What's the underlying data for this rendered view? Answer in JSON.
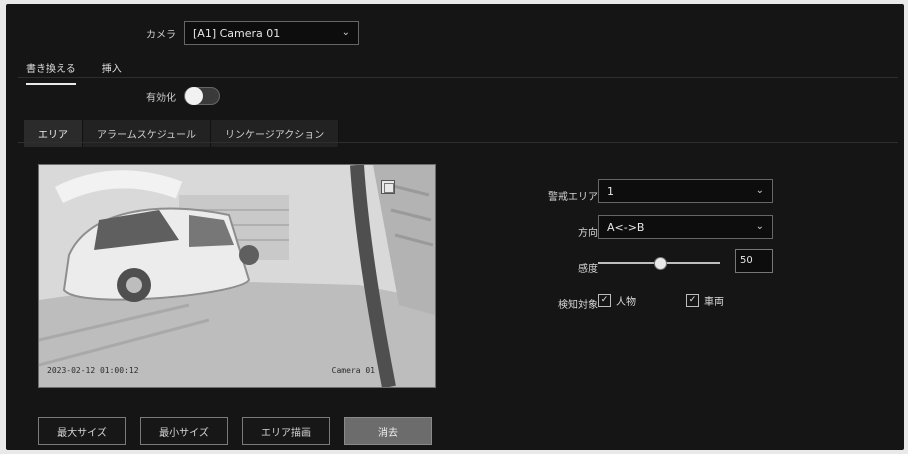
{
  "camera": {
    "label": "カメラ",
    "selected": "[A1] Camera 01"
  },
  "subnav": {
    "items": [
      "書き換える",
      "挿入"
    ]
  },
  "enable": {
    "label": "有効化",
    "on": false
  },
  "tabs": [
    "エリア",
    "アラームスケジュール",
    "リンケージアクション"
  ],
  "preview": {
    "timestamp": "2023-02-12 01:00:12",
    "camera_name": "Camera 01"
  },
  "form": {
    "area_label": "警戒エリア",
    "area_value": "1",
    "direction_label": "方向",
    "direction_value": "A<->B",
    "sensitivity_label": "感度",
    "sensitivity_value": "50",
    "sensitivity_fraction": 0.5,
    "target_label": "検知対象",
    "target_options": [
      {
        "label": "人物",
        "checked": true
      },
      {
        "label": "車両",
        "checked": true
      }
    ]
  },
  "buttons": [
    "最大サイズ",
    "最小サイズ",
    "エリア描画",
    "消去"
  ],
  "colors": {
    "background": "#151515",
    "primary_button": "#6c6c6c"
  },
  "icons": {
    "dropdown": "chevron-down-icon",
    "checkbox": "check-icon",
    "overlay": "grid-icon"
  }
}
